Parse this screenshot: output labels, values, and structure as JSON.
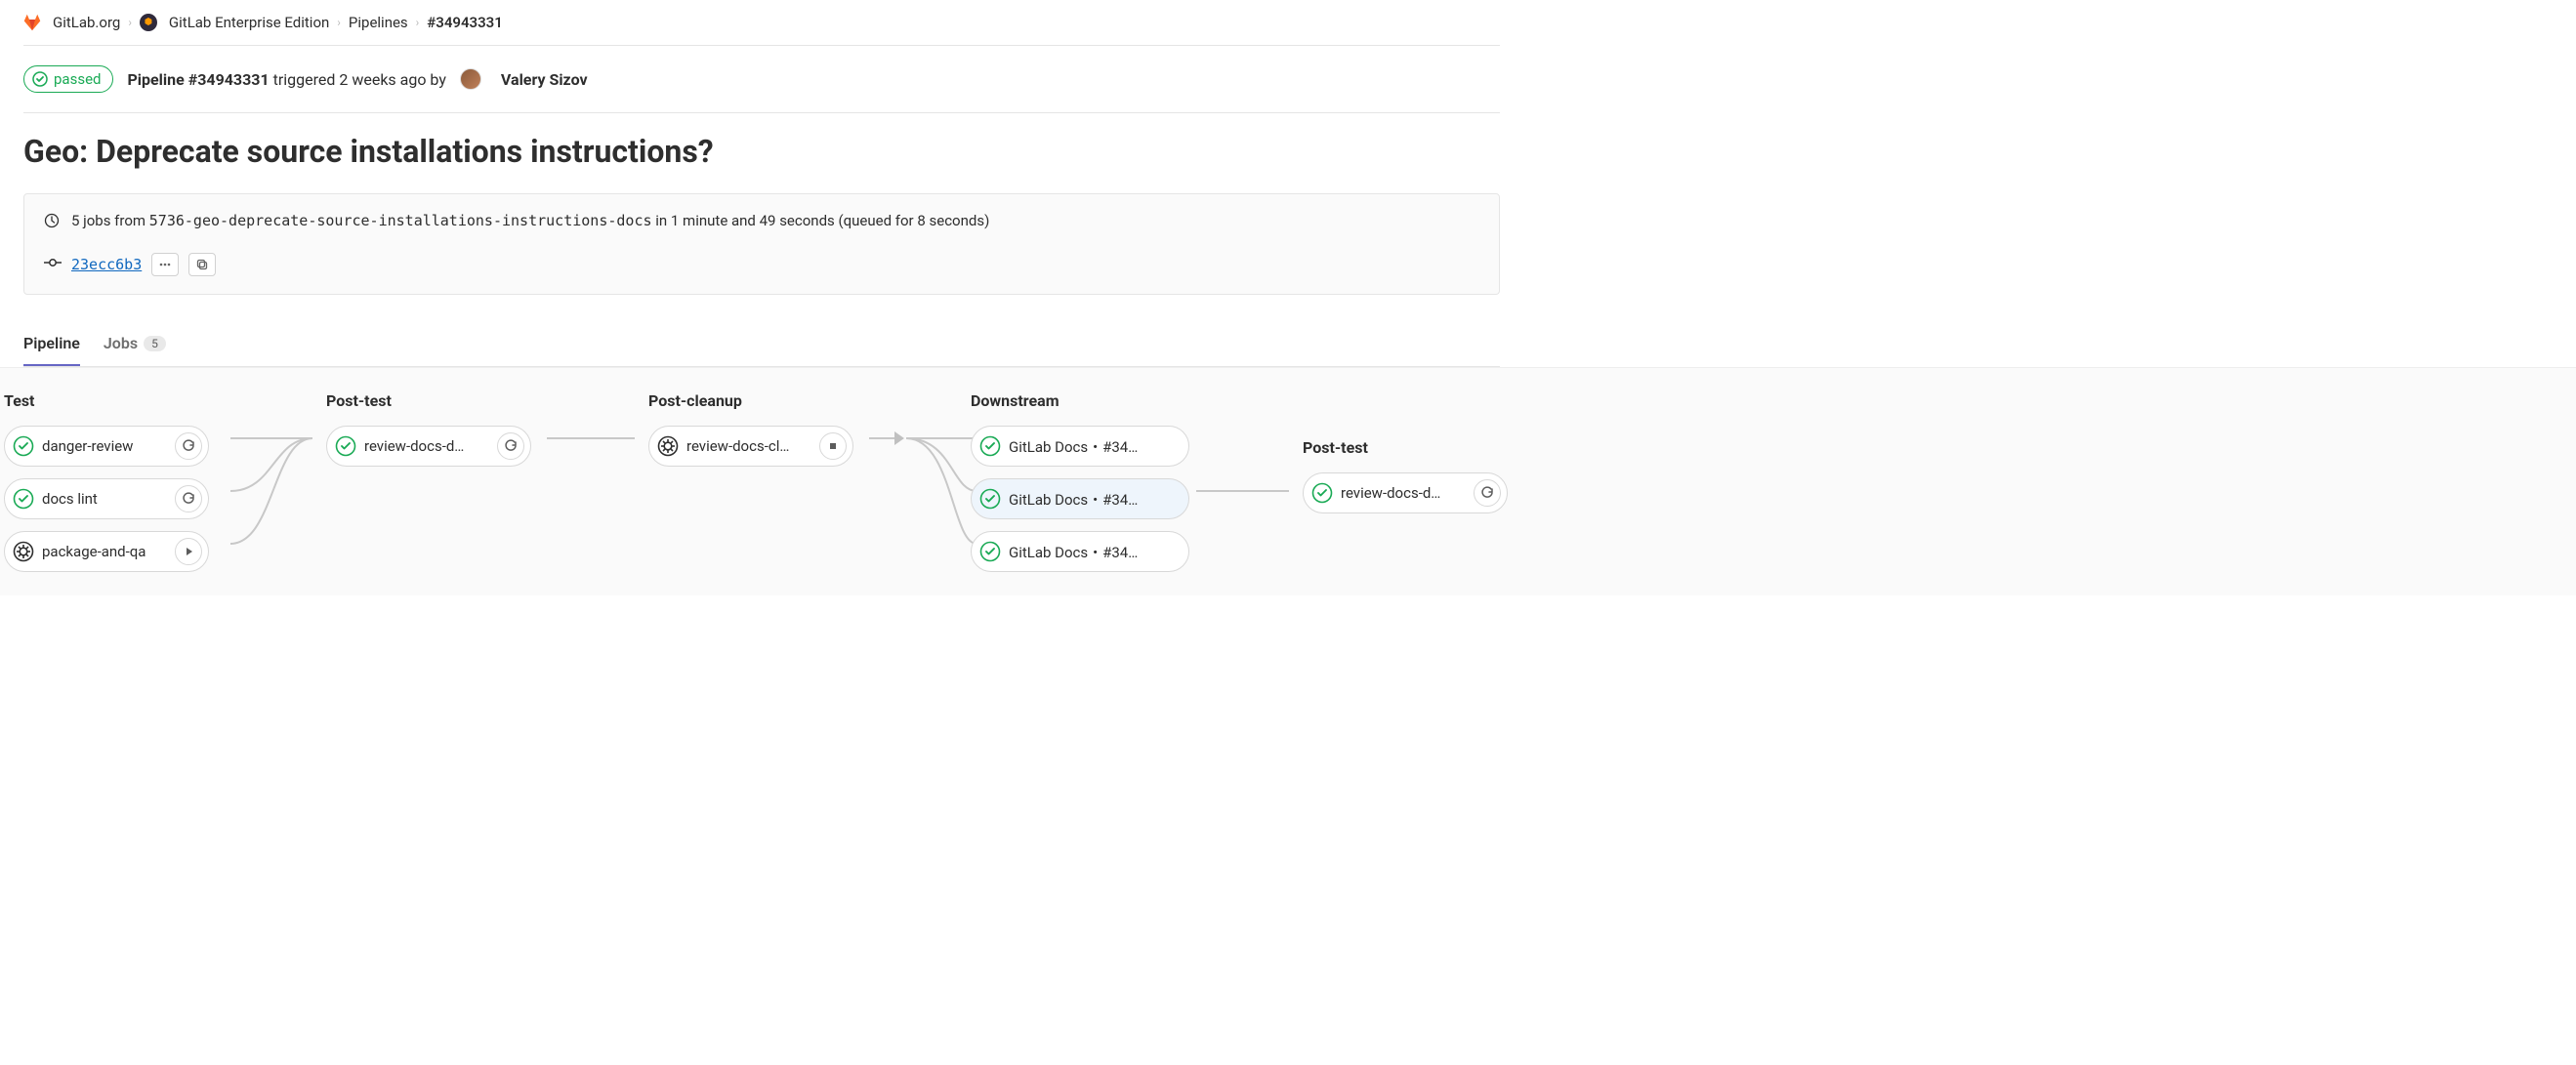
{
  "breadcrumbs": {
    "org": "GitLab.org",
    "project": "GitLab Enterprise Edition",
    "section": "Pipelines",
    "current": "#34943331"
  },
  "status": {
    "label": "passed"
  },
  "header": {
    "pipeline_label": "Pipeline #34943331",
    "trigger_text": " triggered 2 weeks ago by ",
    "author": "Valery Sizov"
  },
  "title": "Geo: Deprecate source installations instructions?",
  "info": {
    "jobs_prefix": "5 jobs from ",
    "branch": "5736-geo-deprecate-source-installations-instructions-docs",
    "timing": " in 1 minute and 49 seconds (queued for 8 seconds)"
  },
  "commit": {
    "sha": "23ecc6b3"
  },
  "tabs": {
    "pipeline": "Pipeline",
    "jobs": "Jobs",
    "jobs_count": "5"
  },
  "stages": [
    {
      "name": "Test",
      "jobs": [
        {
          "label": "danger-review",
          "status": "passed",
          "action": "retry"
        },
        {
          "label": "docs lint",
          "status": "passed",
          "action": "retry"
        },
        {
          "label": "package-and-qa",
          "status": "manual",
          "action": "play"
        }
      ]
    },
    {
      "name": "Post-test",
      "jobs": [
        {
          "label": "review-docs-d…",
          "status": "passed",
          "action": "retry"
        }
      ]
    },
    {
      "name": "Post-cleanup",
      "jobs": [
        {
          "label": "review-docs-cl…",
          "status": "manual",
          "action": "stop"
        }
      ]
    },
    {
      "name": "Downstream",
      "jobs": [
        {
          "label": "GitLab Docs・#34…",
          "status": "passed",
          "action": "none"
        },
        {
          "label": "GitLab Docs・#34…",
          "status": "passed",
          "action": "none",
          "selected": true
        },
        {
          "label": "GitLab Docs・#34…",
          "status": "passed",
          "action": "none"
        }
      ]
    },
    {
      "name": "Post-test",
      "offset": true,
      "jobs": [
        {
          "label": "review-docs-d…",
          "status": "passed",
          "action": "retry"
        }
      ]
    }
  ]
}
